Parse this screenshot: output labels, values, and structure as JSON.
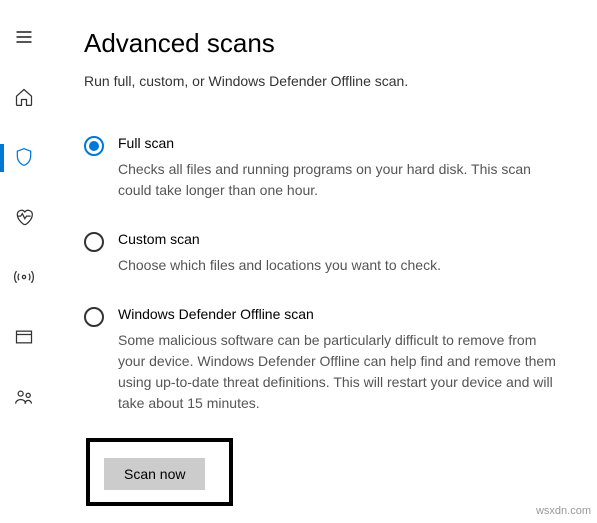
{
  "header": {
    "title": "Advanced scans",
    "subtitle": "Run full, custom, or Windows Defender Offline scan."
  },
  "options": [
    {
      "label": "Full scan",
      "desc": "Checks all files and running programs on your hard disk. This scan could take longer than one hour.",
      "selected": true
    },
    {
      "label": "Custom scan",
      "desc": "Choose which files and locations you want to check.",
      "selected": false
    },
    {
      "label": "Windows Defender Offline scan",
      "desc": "Some malicious software can be particularly difficult to remove from your device. Windows Defender Offline can help find and remove them using up-to-date threat definitions. This will restart your device and will take about 15 minutes.",
      "selected": false
    }
  ],
  "action": {
    "scan_now": "Scan now"
  },
  "watermark": "wsxdn.com"
}
